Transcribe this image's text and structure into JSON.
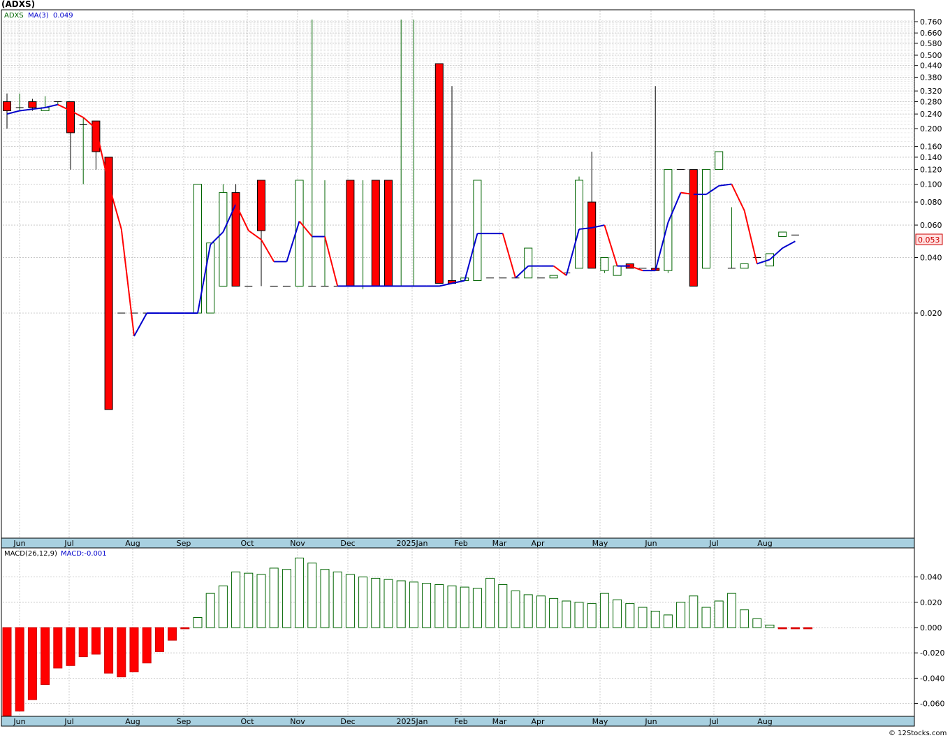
{
  "title": "(ADXS)",
  "footer": "© 12Stocks.com",
  "colors": {
    "up": "#006400",
    "down": "#ff0000",
    "ma": "#0000cc",
    "ma_down": "#ff0000",
    "axis_band": "#a8d0e0",
    "grid": "#c0c0c0"
  },
  "price_panel": {
    "legend": {
      "ticker": "ADXS",
      "ma_label": "MA(3)",
      "ma_value": "0.049"
    },
    "last_price_label": "0.053",
    "y_ticks": [
      "0.760",
      "0.660",
      "0.580",
      "0.500",
      "0.440",
      "0.380",
      "0.320",
      "0.280",
      "0.240",
      "0.200",
      "0.160",
      "0.140",
      "0.120",
      "0.100",
      "0.080",
      "0.060",
      "0.040",
      "0.020"
    ],
    "x_labels": [
      "Jun",
      "Jul",
      "Aug",
      "Sep",
      "Oct",
      "Nov",
      "Dec",
      "2025Jan",
      "Feb",
      "Mar",
      "Apr",
      "May",
      "Jun",
      "Jul",
      "Aug"
    ]
  },
  "macd_panel": {
    "legend": {
      "label": "MACD(26,12,9)",
      "value_label": "MACD:-0.001"
    },
    "y_ticks": [
      "0.040",
      "0.020",
      "0.000",
      "-0.020",
      "-0.040",
      "-0.060"
    ],
    "x_labels": [
      "Jun",
      "Jul",
      "Aug",
      "Sep",
      "Oct",
      "Nov",
      "Dec",
      "2025Jan",
      "Feb",
      "Mar",
      "Apr",
      "May",
      "Jun",
      "Jul",
      "Aug"
    ]
  },
  "chart_data": [
    {
      "type": "candlestick",
      "title": "(ADXS)",
      "scale": "log",
      "ylim": [
        0.012,
        0.8
      ],
      "series": [
        {
          "name": "ADXS",
          "ohlc": [
            [
              0.28,
              0.31,
              0.2,
              0.25
            ],
            [
              0.26,
              0.31,
              0.25,
              0.26
            ],
            [
              0.28,
              0.29,
              0.25,
              0.26
            ],
            [
              0.25,
              0.3,
              0.25,
              0.26
            ],
            [
              0.28,
              0.28,
              0.27,
              0.28
            ],
            [
              0.28,
              0.28,
              0.12,
              0.19
            ],
            [
              0.21,
              0.23,
              0.1,
              0.21
            ],
            [
              0.22,
              0.22,
              0.12,
              0.15
            ],
            [
              0.14,
              0.14,
              0.006,
              0.006
            ],
            [
              0.02,
              0.02,
              0.02,
              0.02
            ],
            [
              0.02,
              0.02,
              0.02,
              0.02
            ],
            [
              0.02,
              0.02,
              0.02,
              0.02
            ],
            [
              0.02,
              0.02,
              0.02,
              0.02
            ],
            [
              0.02,
              0.02,
              0.02,
              0.02
            ],
            [
              0.02,
              0.02,
              0.02,
              0.02
            ],
            [
              0.02,
              0.1,
              0.02,
              0.1
            ],
            [
              0.02,
              0.048,
              0.02,
              0.048
            ],
            [
              0.028,
              0.1,
              0.028,
              0.09
            ],
            [
              0.09,
              0.1,
              0.028,
              0.028
            ],
            [
              0.028,
              0.028,
              0.028,
              0.028
            ],
            [
              0.105,
              0.105,
              0.028,
              0.056
            ],
            [
              0.028,
              0.028,
              0.028,
              0.028
            ],
            [
              0.028,
              0.028,
              0.028,
              0.028
            ],
            [
              0.028,
              0.105,
              0.028,
              0.105
            ],
            [
              0.028,
              0.78,
              0.028,
              0.028
            ],
            [
              0.028,
              0.105,
              0.028,
              0.028
            ],
            [
              0.028,
              0.028,
              0.028,
              0.028
            ],
            [
              0.105,
              0.105,
              0.028,
              0.028
            ],
            [
              0.028,
              0.105,
              0.027,
              0.028
            ],
            [
              0.105,
              0.105,
              0.028,
              0.028
            ],
            [
              0.105,
              0.105,
              0.028,
              0.028
            ],
            [
              0.028,
              0.78,
              0.028,
              0.028
            ],
            [
              0.028,
              0.78,
              0.028,
              0.028
            ],
            [
              0.028,
              0.028,
              0.028,
              0.028
            ],
            [
              0.45,
              0.45,
              0.029,
              0.029
            ],
            [
              0.03,
              0.34,
              0.029,
              0.029
            ],
            [
              0.03,
              0.03,
              0.03,
              0.031
            ],
            [
              0.03,
              0.105,
              0.03,
              0.105
            ],
            [
              0.031,
              0.031,
              0.031,
              0.031
            ],
            [
              0.031,
              0.031,
              0.031,
              0.031
            ],
            [
              0.031,
              0.031,
              0.031,
              0.031
            ],
            [
              0.031,
              0.045,
              0.031,
              0.045
            ],
            [
              0.031,
              0.031,
              0.031,
              0.031
            ],
            [
              0.031,
              0.031,
              0.031,
              0.032
            ],
            [
              0.033,
              0.033,
              0.033,
              0.033
            ],
            [
              0.035,
              0.11,
              0.035,
              0.105
            ],
            [
              0.08,
              0.15,
              0.035,
              0.035
            ],
            [
              0.034,
              0.04,
              0.033,
              0.04
            ],
            [
              0.032,
              0.036,
              0.032,
              0.036
            ],
            [
              0.037,
              0.037,
              0.035,
              0.035
            ],
            [
              0.035,
              0.035,
              0.035,
              0.035
            ],
            [
              0.035,
              0.34,
              0.034,
              0.034
            ],
            [
              0.034,
              0.12,
              0.033,
              0.12
            ],
            [
              0.12,
              0.12,
              0.12,
              0.12
            ],
            [
              0.12,
              0.12,
              0.028,
              0.028
            ],
            [
              0.035,
              0.12,
              0.035,
              0.12
            ],
            [
              0.12,
              0.15,
              0.12,
              0.15
            ],
            [
              0.035,
              0.075,
              0.035,
              0.035
            ],
            [
              0.035,
              0.037,
              0.035,
              0.037
            ],
            [
              0.04,
              0.04,
              0.04,
              0.04
            ],
            [
              0.036,
              0.042,
              0.036,
              0.042
            ],
            [
              0.052,
              0.055,
              0.052,
              0.055
            ],
            [
              0.053,
              0.053,
              0.053,
              0.053
            ]
          ]
        },
        {
          "name": "MA(3)",
          "values": [
            0.24,
            0.25,
            0.255,
            0.26,
            0.27,
            0.25,
            0.23,
            0.2,
            0.1,
            0.057,
            0.015,
            0.02,
            0.02,
            0.02,
            0.02,
            0.02,
            0.047,
            0.055,
            0.078,
            0.056,
            0.05,
            0.038,
            0.038,
            0.063,
            0.052,
            0.052,
            0.028,
            0.028,
            0.028,
            0.028,
            0.028,
            0.028,
            0.028,
            0.028,
            0.028,
            0.029,
            0.03,
            0.054,
            0.054,
            0.054,
            0.031,
            0.036,
            0.036,
            0.036,
            0.032,
            0.057,
            0.058,
            0.06,
            0.036,
            0.036,
            0.034,
            0.034,
            0.062,
            0.09,
            0.088,
            0.088,
            0.098,
            0.1,
            0.072,
            0.037,
            0.039,
            0.045,
            0.049
          ]
        }
      ]
    },
    {
      "type": "bar",
      "title": "MACD(26,12,9)",
      "ylim": [
        -0.07,
        0.055
      ],
      "series": [
        {
          "name": "MACD",
          "values": [
            -0.07,
            -0.066,
            -0.057,
            -0.045,
            -0.032,
            -0.03,
            -0.023,
            -0.021,
            -0.036,
            -0.039,
            -0.035,
            -0.028,
            -0.019,
            -0.01,
            -0.001,
            0.008,
            0.027,
            0.033,
            0.044,
            0.043,
            0.042,
            0.047,
            0.046,
            0.055,
            0.051,
            0.046,
            0.044,
            0.042,
            0.04,
            0.039,
            0.038,
            0.037,
            0.036,
            0.035,
            0.034,
            0.033,
            0.032,
            0.031,
            0.039,
            0.034,
            0.029,
            0.026,
            0.025,
            0.023,
            0.021,
            0.02,
            0.019,
            0.027,
            0.022,
            0.019,
            0.016,
            0.013,
            0.01,
            0.02,
            0.025,
            0.016,
            0.021,
            0.027,
            0.014,
            0.007,
            0.002,
            -0.001,
            -0.001,
            -0.001
          ]
        }
      ]
    }
  ]
}
